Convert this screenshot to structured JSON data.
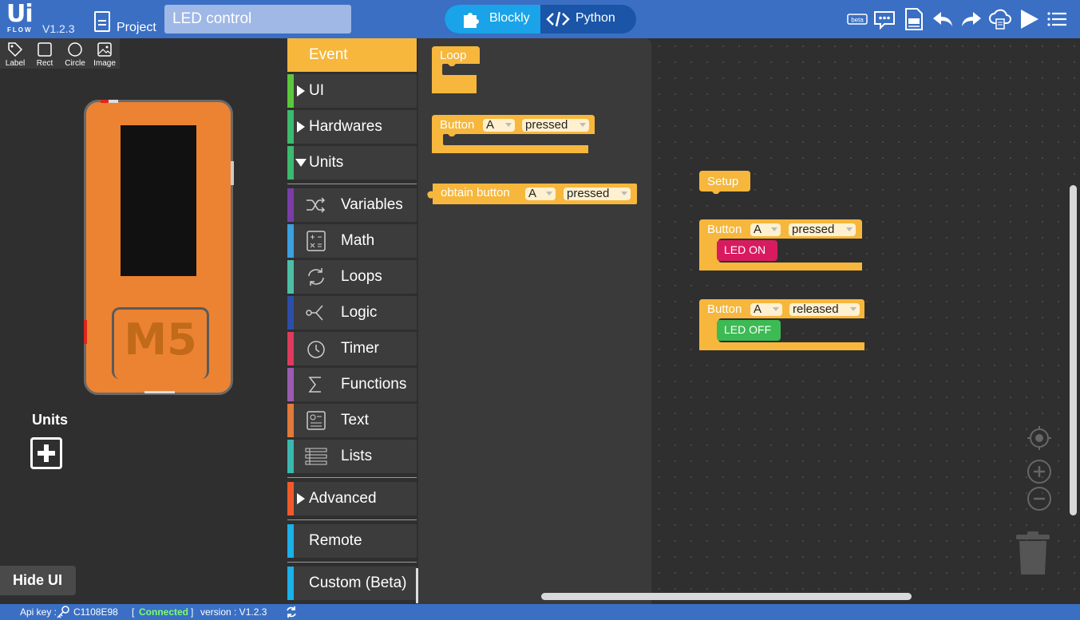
{
  "app": {
    "logo_top": "Ui",
    "logo_bottom": "FLOW",
    "version": "V1.2.3",
    "project_label": "Project",
    "project_name": "LED control"
  },
  "mode_toggle": {
    "blockly_label": "Blockly",
    "python_label": "Python",
    "active": "Blockly"
  },
  "top_actions": {
    "beta_label": "beta"
  },
  "ui_tools": [
    {
      "label": "Label",
      "icon": "tag-icon"
    },
    {
      "label": "Rect",
      "icon": "rect-icon"
    },
    {
      "label": "Circle",
      "icon": "circle-icon"
    },
    {
      "label": "Image",
      "icon": "image-icon"
    }
  ],
  "device": {
    "brand": "M5",
    "color": "#ec8332"
  },
  "units_panel": {
    "title": "Units"
  },
  "hide_ui_label": "Hide UI",
  "categories": [
    {
      "label": "Event",
      "color": "#f6b73c",
      "selected": true
    },
    {
      "label": "UI",
      "color": "#5cc73b",
      "expandable": true
    },
    {
      "label": "Hardwares",
      "color": "#3cba6e",
      "expandable": true
    },
    {
      "label": "Units",
      "color": "#3cba6e",
      "expanded": true
    },
    {
      "label": "Variables",
      "color": "#7a3da8",
      "icon": "shuffle-icon"
    },
    {
      "label": "Math",
      "color": "#3aa0e0",
      "icon": "calculator-icon"
    },
    {
      "label": "Loops",
      "color": "#4cbfa6",
      "icon": "loop-icon"
    },
    {
      "label": "Logic",
      "color": "#2d4ea8",
      "icon": "logic-icon"
    },
    {
      "label": "Timer",
      "color": "#e03a5e",
      "icon": "clock-icon"
    },
    {
      "label": "Functions",
      "color": "#9a5cb0",
      "icon": "sigma-icon"
    },
    {
      "label": "Text",
      "color": "#e07a3a",
      "icon": "text-icon"
    },
    {
      "label": "Lists",
      "color": "#3ab8b0",
      "icon": "list-icon"
    },
    {
      "label": "Advanced",
      "color": "#f05a2a",
      "expandable": true
    },
    {
      "label": "Remote",
      "color": "#1ab0e8"
    },
    {
      "label": "Custom (Beta)",
      "color": "#1ab0e8"
    }
  ],
  "flyout_blocks": {
    "loop": "Loop",
    "button_event": {
      "label": "Button",
      "button": "A",
      "action": "pressed"
    },
    "obtain_button": {
      "label": "obtain button",
      "button": "A",
      "action": "pressed"
    }
  },
  "workspace_blocks": {
    "setup": "Setup",
    "pressed_event": {
      "label": "Button",
      "button": "A",
      "action": "pressed",
      "child": "LED ON",
      "child_color": "#d81b60"
    },
    "released_event": {
      "label": "Button",
      "button": "A",
      "action": "released",
      "child": "LED OFF",
      "child_color": "#3cba54"
    }
  },
  "status": {
    "api_key_label": "Api key :",
    "api_key": "C1108E98",
    "connection_open": "[",
    "connection": "Connected",
    "connection_close": "]",
    "version_text": "version : V1.2.3",
    "connected_color": "#7dff6a"
  }
}
